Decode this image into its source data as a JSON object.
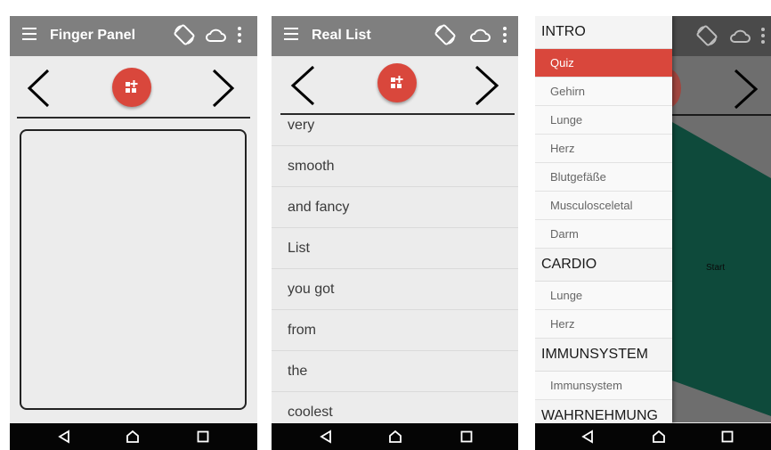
{
  "panel1": {
    "title": "Finger Panel"
  },
  "panel2": {
    "title": "Real List",
    "items": [
      "very",
      "smooth",
      "and fancy",
      "List",
      "you got",
      "from",
      "the",
      "coolest"
    ]
  },
  "panel3": {
    "canvas_label": "Start",
    "drawer": {
      "sections": [
        {
          "label": "INTRO",
          "items": [
            "Quiz",
            "Gehirn",
            "Lunge",
            "Herz",
            "Blutgefäße",
            "Musculosceletal",
            "Darm"
          ]
        },
        {
          "label": "CARDIO",
          "items": [
            "Lunge",
            "Herz"
          ]
        },
        {
          "label": "IMMUNSYSTEM",
          "items": [
            "Immunsystem"
          ]
        },
        {
          "label": "WAHRNEHMUNG",
          "items": []
        }
      ],
      "selected_item": "Quiz"
    }
  },
  "icons": [
    "menu-icon",
    "screen-rotation-icon",
    "cloud-icon",
    "more-vert-icon",
    "chevron-left-icon",
    "chevron-right-icon",
    "grid-add-icon",
    "back-icon",
    "home-icon",
    "recents-icon"
  ],
  "colors": {
    "appbar": "#7f7f7f",
    "accent": "#d9473c",
    "background": "#ececec",
    "navbar": "#050505",
    "canvas_green": "#0e4a3b"
  }
}
